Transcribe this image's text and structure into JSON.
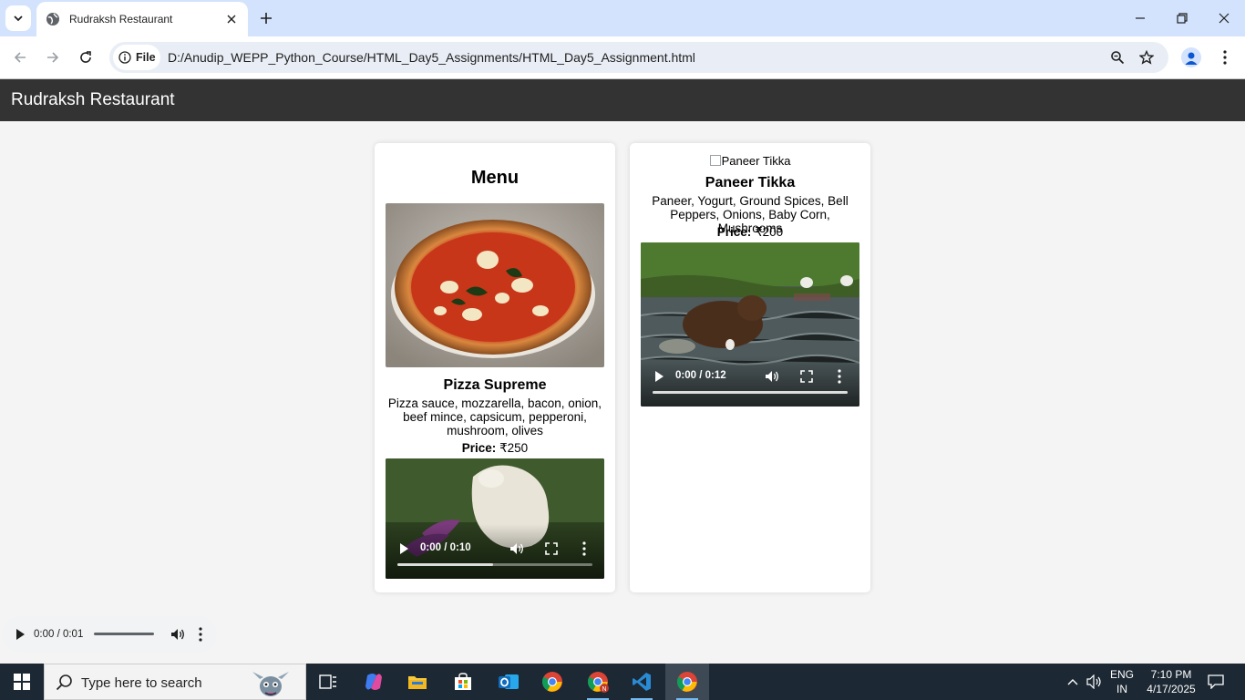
{
  "browser": {
    "tab_title": "Rudraksh Restaurant",
    "file_chip": "File",
    "url": "D:/Anudip_WEPP_Python_Course/HTML_Day5_Assignments/HTML_Day5_Assignment.html"
  },
  "page": {
    "site_title": "Rudraksh Restaurant",
    "menu_title": "Menu",
    "items": [
      {
        "image_alt": "Pizza",
        "name": "Pizza Supreme",
        "description": "Pizza sauce, mozzarella, bacon, onion, beef mince, capsicum, pepperoni, mushroom, olives",
        "price_label": "Price:",
        "price_value": "₹250",
        "video": {
          "time": "0:00 / 0:10",
          "buffered": 0.49
        }
      },
      {
        "image_alt": "Paneer Tikka",
        "name": "Paneer Tikka",
        "description": "Paneer, Yogurt, Ground Spices, Bell Peppers, Onions, Baby Corn, Mushrooms",
        "price_label": "Price:",
        "price_value": "₹200",
        "video": {
          "time": "0:00 / 0:12",
          "buffered": 1.0
        }
      }
    ],
    "audio": {
      "time": "0:00 / 0:01"
    }
  },
  "taskbar": {
    "search_placeholder": "Type here to search",
    "lang_top": "ENG",
    "lang_bottom": "IN",
    "time": "7:10 PM",
    "date": "4/17/2025"
  },
  "colors": {
    "header_bg": "#333333",
    "page_bg": "#f4f4f4",
    "tabbar_bg": "#d3e3fd",
    "taskbar_bg": "#1c2833"
  }
}
